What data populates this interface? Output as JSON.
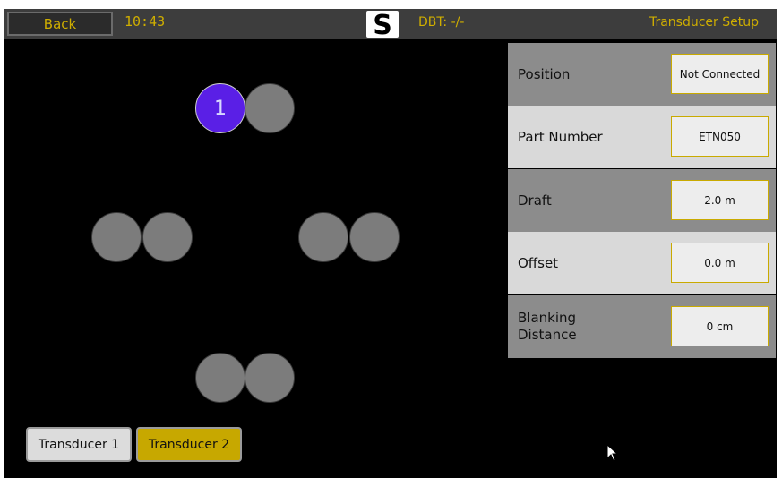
{
  "topbar": {
    "back_label": "Back",
    "time": "10:43",
    "logo_text": "S",
    "dbt": "DBT: -/-",
    "title": "Transducer Setup"
  },
  "settings": [
    {
      "label": "Position",
      "value": "Not Connected"
    },
    {
      "label": "Part Number",
      "value": "ETN050"
    },
    {
      "label": "Draft",
      "value": "2.0 m"
    },
    {
      "label": "Offset",
      "value": "0.0 m"
    },
    {
      "label": "Blanking\nDistance",
      "value": "0 cm"
    }
  ],
  "positions": {
    "selected_label": "1"
  },
  "tabs": [
    {
      "label": "Transducer 1"
    },
    {
      "label": "Transducer 2"
    }
  ],
  "colors": {
    "accent": "#cfae00",
    "selected_position": "#5a1fe6",
    "empty_position": "#7c7c7c",
    "active_tab": "#c7a800"
  },
  "icons": [
    "s-logo-icon",
    "mouse-pointer-icon"
  ]
}
